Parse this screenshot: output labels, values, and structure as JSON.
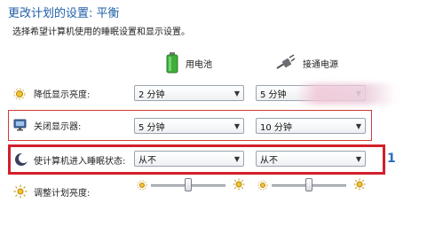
{
  "header": {
    "title": "更改计划的设置: 平衡",
    "subtitle": "选择希望计算机使用的睡眠设置和显示设置。"
  },
  "columns": {
    "battery": {
      "label": "用电池",
      "icon": "battery-icon"
    },
    "plugged": {
      "label": "接通电源",
      "icon": "plug-icon"
    }
  },
  "rows": [
    {
      "label": "降低显示亮度:",
      "icon": "dim-display-icon",
      "battery": "2 分钟",
      "plugged": "5 分钟"
    },
    {
      "label": "关闭显示器:",
      "icon": "monitor-icon",
      "battery": "5 分钟",
      "plugged": "10 分钟"
    },
    {
      "label": "使计算机进入睡眠状态:",
      "icon": "sleep-moon-icon",
      "battery": "从不",
      "plugged": "从不"
    }
  ],
  "brightness": {
    "label": "调整计划亮度:",
    "icon": "brightness-sun-icon",
    "battery_level": 0.5,
    "plugged_level": 0.5
  },
  "annotation": {
    "marker": "1"
  },
  "colors": {
    "title": "#1f5fa8",
    "highlight_thin": "#d23a3a",
    "highlight_thick": "#d21f2a",
    "marker": "#2a6fbd"
  }
}
